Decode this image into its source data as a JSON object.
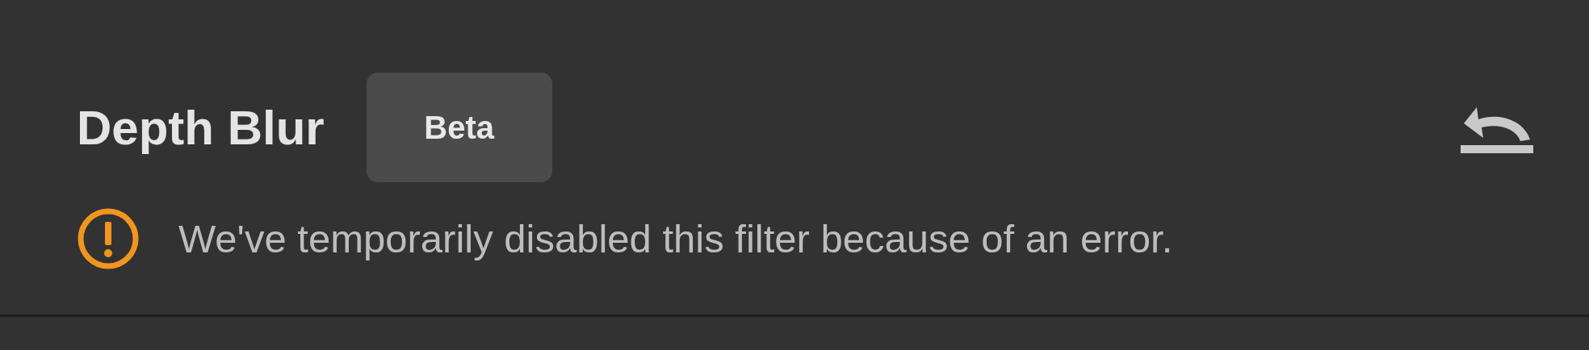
{
  "panel": {
    "title": "Depth Blur",
    "badge": "Beta",
    "message": "We've temporarily disabled this filter because of an error."
  }
}
